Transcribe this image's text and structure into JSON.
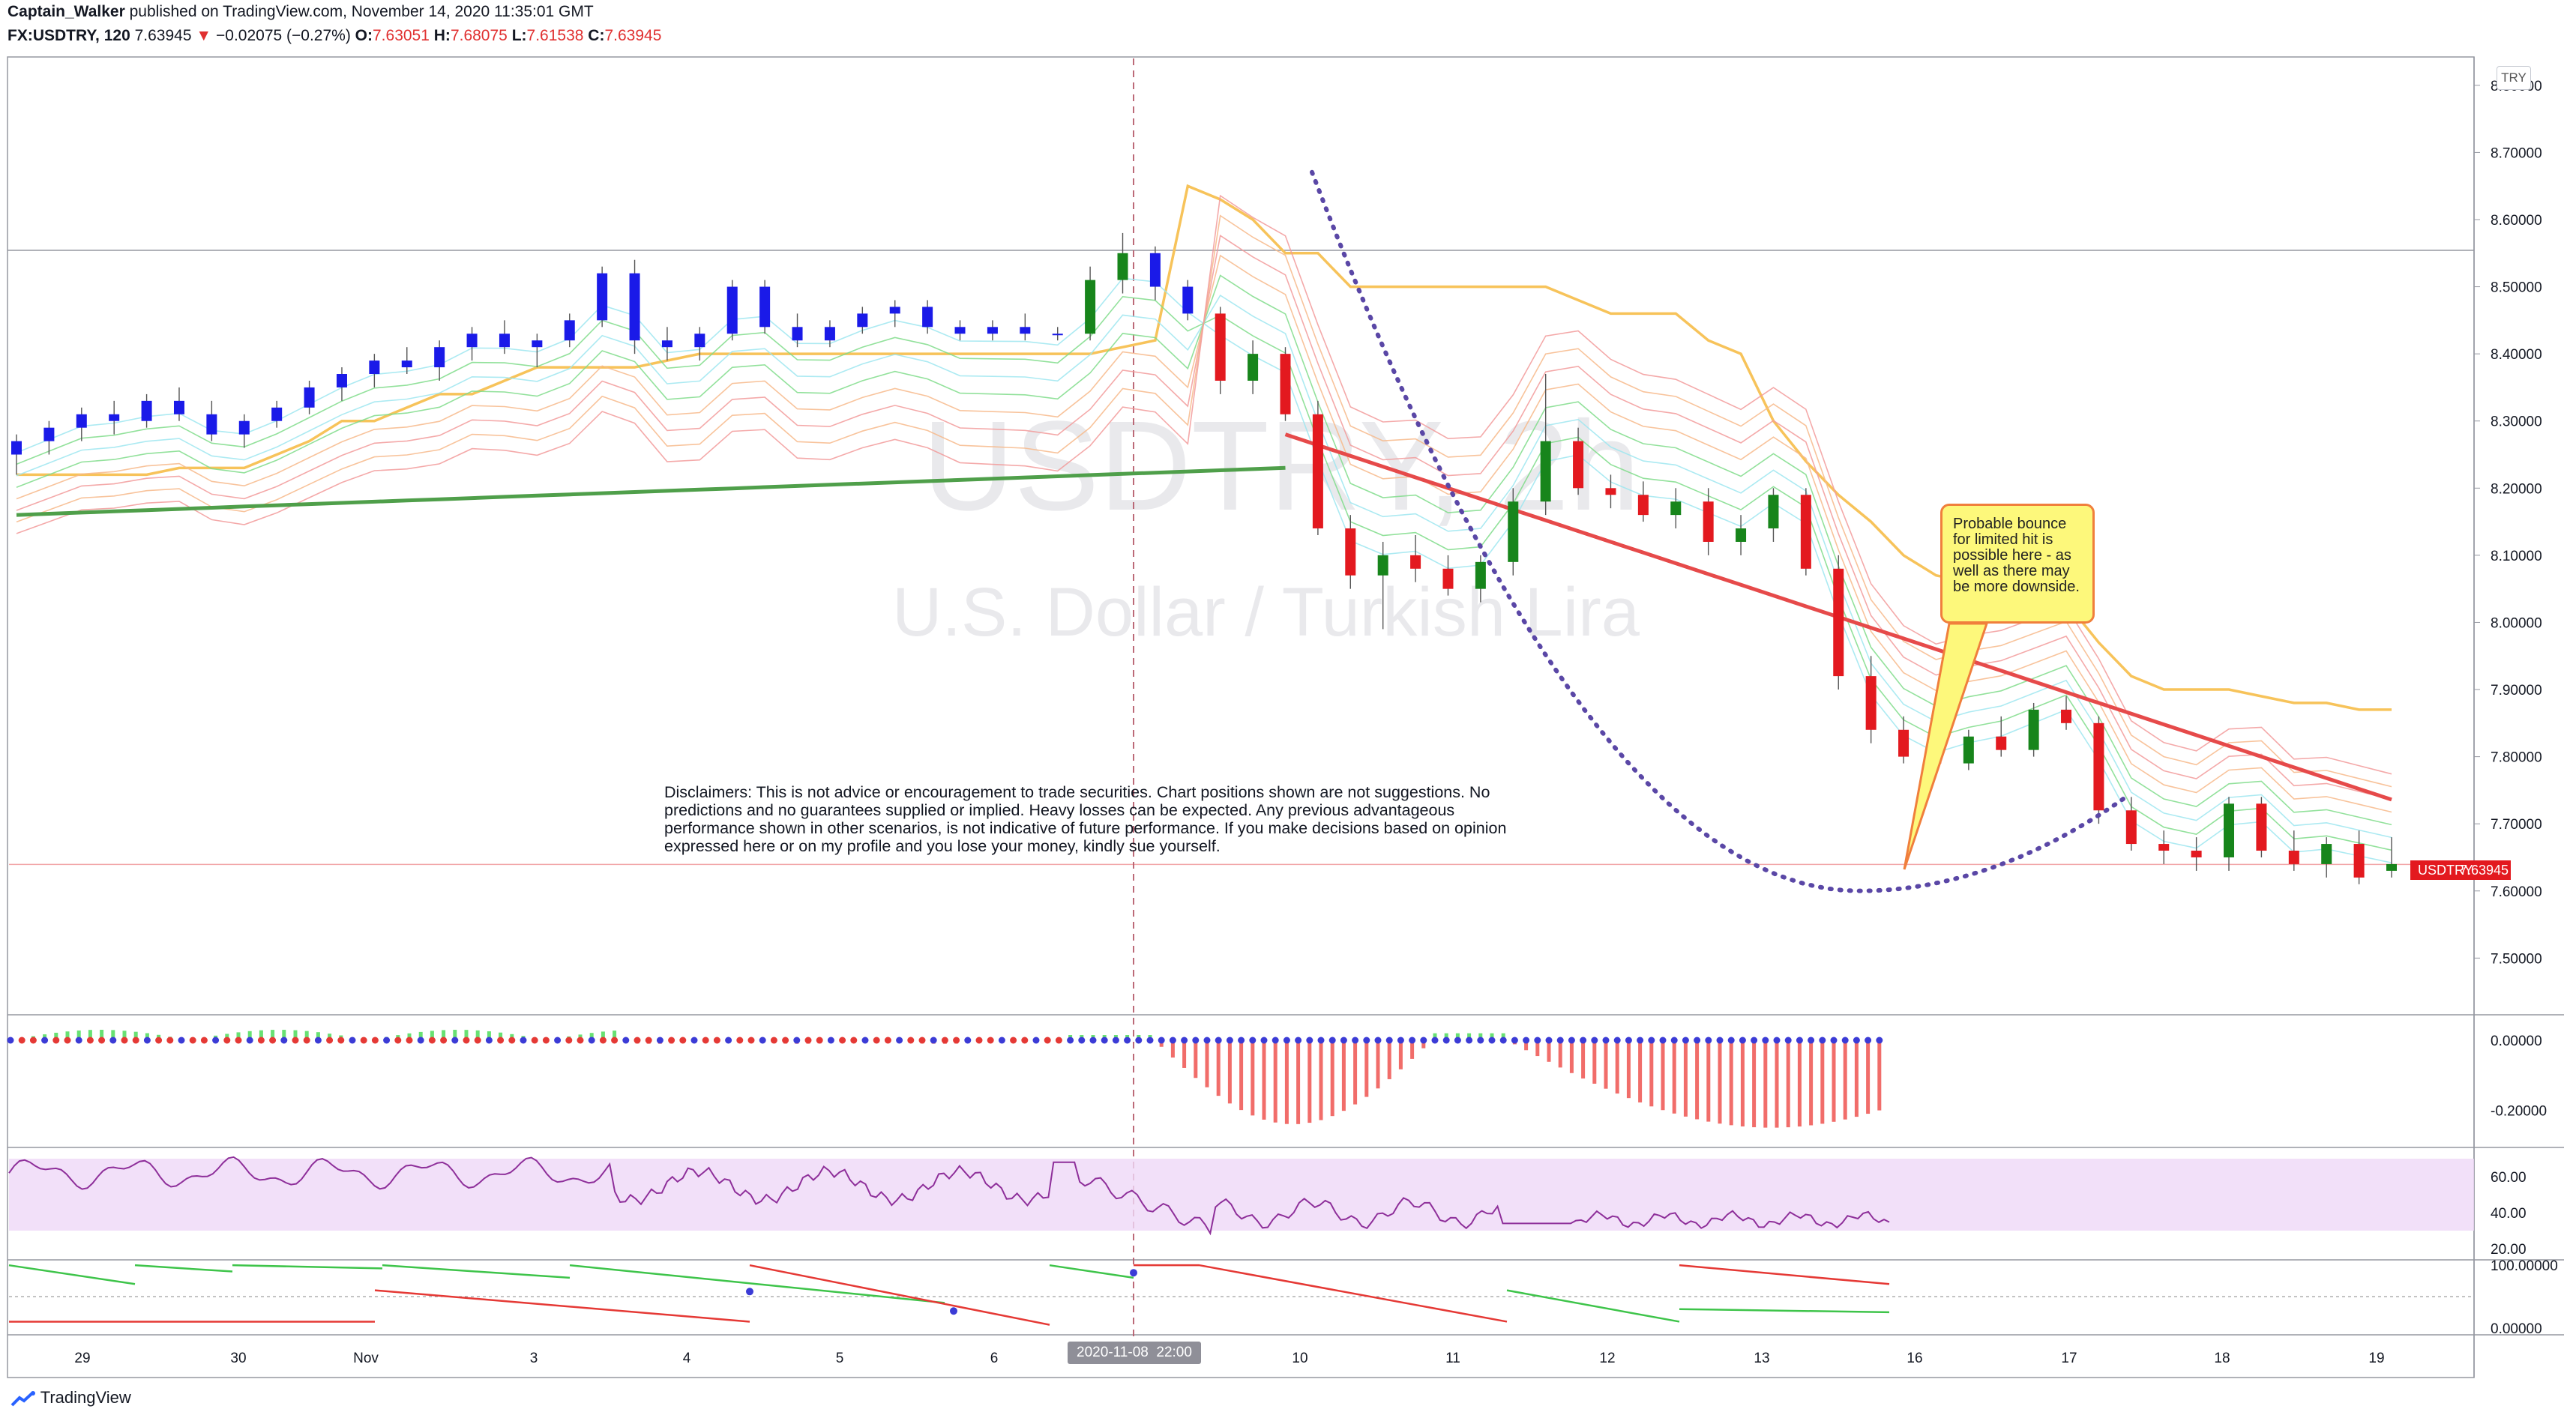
{
  "header": {
    "author": "Captain_Walker",
    "published_text": "published on TradingView.com, November 14, 2020 11:35:01 GMT",
    "symbol": "FX:USDTRY, 120",
    "last": "7.63945",
    "change": "−0.02075 (−0.27%)",
    "open_label": "O:",
    "open": "7.63051",
    "high_label": "H:",
    "high": "7.68075",
    "low_label": "L:",
    "low": "7.61538",
    "close_label": "C:",
    "close": "7.63945"
  },
  "watermark": {
    "symbol": "USDTRY, 2h",
    "name": "U.S. Dollar / Turkish Lira"
  },
  "currency_button": "TRY",
  "price_badge": {
    "label": "USDTRY",
    "value": "7.63945"
  },
  "crosshair_date": {
    "date": "2020-11-08",
    "time": "22:00"
  },
  "disclaimer": "Disclaimers: This is not advice or encouragement to trade securities. Chart positions shown are not suggestions. No predictions and no guarantees supplied or implied. Heavy losses can be expected. Any previous advantageous performance shown in other scenarios, is not indicative of future performance.  If you make decisions based on opinion expressed here or on my profile and you lose your money, kindly sue yourself.",
  "callout": "Probable bounce for limited hit is possible here - as well as there may be more downside.",
  "footer": "TradingView",
  "colors": {
    "up": "#17851b",
    "up_blue": "#1a1ae8",
    "down": "#e3191f",
    "ma_long": "#f7c35a",
    "ma_long2": "#f5b878",
    "green_ma": "#4f9f4a",
    "red_ma": "#e64a4a",
    "dots": "#5a47a6",
    "osc_purple": "#8e2f9a"
  },
  "chart_data": [
    {
      "type": "line",
      "title": "USDTRY, 2h",
      "panel": "price",
      "ylim": [
        7.42,
        8.84
      ],
      "y_ticks": [
        "8.80000",
        "8.70000",
        "8.60000",
        "8.50000",
        "8.40000",
        "8.30000",
        "8.20000",
        "8.10000",
        "8.00000",
        "7.90000",
        "7.80000",
        "7.70000",
        "7.60000",
        "7.50000"
      ],
      "x_tick_labels": [
        "29",
        "30",
        "Nov",
        "3",
        "4",
        "5",
        "6",
        "10",
        "11",
        "12",
        "13",
        "16",
        "17",
        "18",
        "19"
      ],
      "candles_ohlc_approx": [
        [
          8.25,
          8.28,
          8.22,
          8.27
        ],
        [
          8.27,
          8.3,
          8.25,
          8.29
        ],
        [
          8.29,
          8.32,
          8.27,
          8.31
        ],
        [
          8.31,
          8.33,
          8.28,
          8.3
        ],
        [
          8.3,
          8.34,
          8.29,
          8.33
        ],
        [
          8.33,
          8.35,
          8.3,
          8.31
        ],
        [
          8.31,
          8.33,
          8.27,
          8.28
        ],
        [
          8.28,
          8.31,
          8.26,
          8.3
        ],
        [
          8.3,
          8.33,
          8.29,
          8.32
        ],
        [
          8.32,
          8.36,
          8.31,
          8.35
        ],
        [
          8.35,
          8.38,
          8.33,
          8.37
        ],
        [
          8.37,
          8.4,
          8.35,
          8.39
        ],
        [
          8.39,
          8.41,
          8.37,
          8.38
        ],
        [
          8.38,
          8.42,
          8.36,
          8.41
        ],
        [
          8.41,
          8.44,
          8.39,
          8.43
        ],
        [
          8.43,
          8.45,
          8.4,
          8.41
        ],
        [
          8.41,
          8.43,
          8.38,
          8.42
        ],
        [
          8.42,
          8.46,
          8.41,
          8.45
        ],
        [
          8.45,
          8.53,
          8.44,
          8.52
        ],
        [
          8.52,
          8.54,
          8.4,
          8.42
        ],
        [
          8.42,
          8.44,
          8.39,
          8.41
        ],
        [
          8.41,
          8.44,
          8.39,
          8.43
        ],
        [
          8.43,
          8.51,
          8.42,
          8.5
        ],
        [
          8.5,
          8.51,
          8.43,
          8.44
        ],
        [
          8.44,
          8.46,
          8.41,
          8.42
        ],
        [
          8.42,
          8.45,
          8.41,
          8.44
        ],
        [
          8.44,
          8.47,
          8.43,
          8.46
        ],
        [
          8.46,
          8.48,
          8.44,
          8.47
        ],
        [
          8.47,
          8.48,
          8.43,
          8.44
        ],
        [
          8.44,
          8.45,
          8.42,
          8.43
        ],
        [
          8.43,
          8.45,
          8.42,
          8.44
        ],
        [
          8.44,
          8.46,
          8.42,
          8.43
        ],
        [
          8.43,
          8.44,
          8.42,
          8.43
        ],
        [
          8.43,
          8.53,
          8.42,
          8.51
        ],
        [
          8.51,
          8.58,
          8.49,
          8.55
        ],
        [
          8.55,
          8.56,
          8.48,
          8.5
        ],
        [
          8.5,
          8.51,
          8.45,
          8.46
        ],
        [
          8.46,
          8.47,
          8.34,
          8.36
        ],
        [
          8.36,
          8.42,
          8.34,
          8.4
        ],
        [
          8.4,
          8.41,
          8.3,
          8.31
        ],
        [
          8.31,
          8.33,
          8.13,
          8.14
        ],
        [
          8.14,
          8.16,
          8.05,
          8.07
        ],
        [
          8.07,
          8.12,
          7.99,
          8.1
        ],
        [
          8.1,
          8.13,
          8.06,
          8.08
        ],
        [
          8.08,
          8.1,
          8.04,
          8.05
        ],
        [
          8.05,
          8.1,
          8.03,
          8.09
        ],
        [
          8.09,
          8.2,
          8.07,
          8.18
        ],
        [
          8.18,
          8.37,
          8.16,
          8.27
        ],
        [
          8.27,
          8.29,
          8.19,
          8.2
        ],
        [
          8.2,
          8.22,
          8.17,
          8.19
        ],
        [
          8.19,
          8.21,
          8.15,
          8.16
        ],
        [
          8.16,
          8.2,
          8.14,
          8.18
        ],
        [
          8.18,
          8.2,
          8.1,
          8.12
        ],
        [
          8.12,
          8.16,
          8.1,
          8.14
        ],
        [
          8.14,
          8.2,
          8.12,
          8.19
        ],
        [
          8.19,
          8.2,
          8.07,
          8.08
        ],
        [
          8.08,
          8.1,
          7.9,
          7.92
        ],
        [
          7.92,
          7.95,
          7.82,
          7.84
        ],
        [
          7.84,
          7.86,
          7.79,
          7.8
        ],
        [
          7.8,
          7.83,
          7.78,
          7.79
        ],
        [
          7.79,
          7.84,
          7.78,
          7.83
        ],
        [
          7.83,
          7.86,
          7.8,
          7.81
        ],
        [
          7.81,
          7.88,
          7.8,
          7.87
        ],
        [
          7.87,
          7.89,
          7.84,
          7.85
        ],
        [
          7.85,
          7.86,
          7.7,
          7.72
        ],
        [
          7.72,
          7.74,
          7.66,
          7.67
        ],
        [
          7.67,
          7.69,
          7.64,
          7.66
        ],
        [
          7.66,
          7.68,
          7.63,
          7.65
        ],
        [
          7.65,
          7.74,
          7.63,
          7.73
        ],
        [
          7.73,
          7.74,
          7.65,
          7.66
        ],
        [
          7.66,
          7.69,
          7.63,
          7.64
        ],
        [
          7.64,
          7.68,
          7.62,
          7.67
        ],
        [
          7.67,
          7.69,
          7.61,
          7.62
        ],
        [
          7.63,
          7.68,
          7.62,
          7.64
        ]
      ],
      "annotations": [
        "dashed vertical marker at 2020-11-08 22:00",
        "dotted purple projected bounce curve to ~7.60 then up to ~7.85"
      ]
    },
    {
      "type": "bar",
      "panel": "momentum histogram",
      "y_ticks": [
        "0.00000",
        "-0.20000"
      ],
      "ylim": [
        -0.3,
        0.06
      ]
    },
    {
      "type": "line",
      "panel": "oscillator (RSI-like)",
      "y_ticks": [
        "60.00",
        "40.00",
        "20.00"
      ],
      "ylim": [
        15,
        75
      ],
      "band": [
        30,
        70
      ]
    },
    {
      "type": "line",
      "panel": "aroon-like oscillator",
      "y_ticks": [
        "100.00000",
        "0.00000"
      ],
      "ylim": [
        -5,
        105
      ]
    }
  ]
}
